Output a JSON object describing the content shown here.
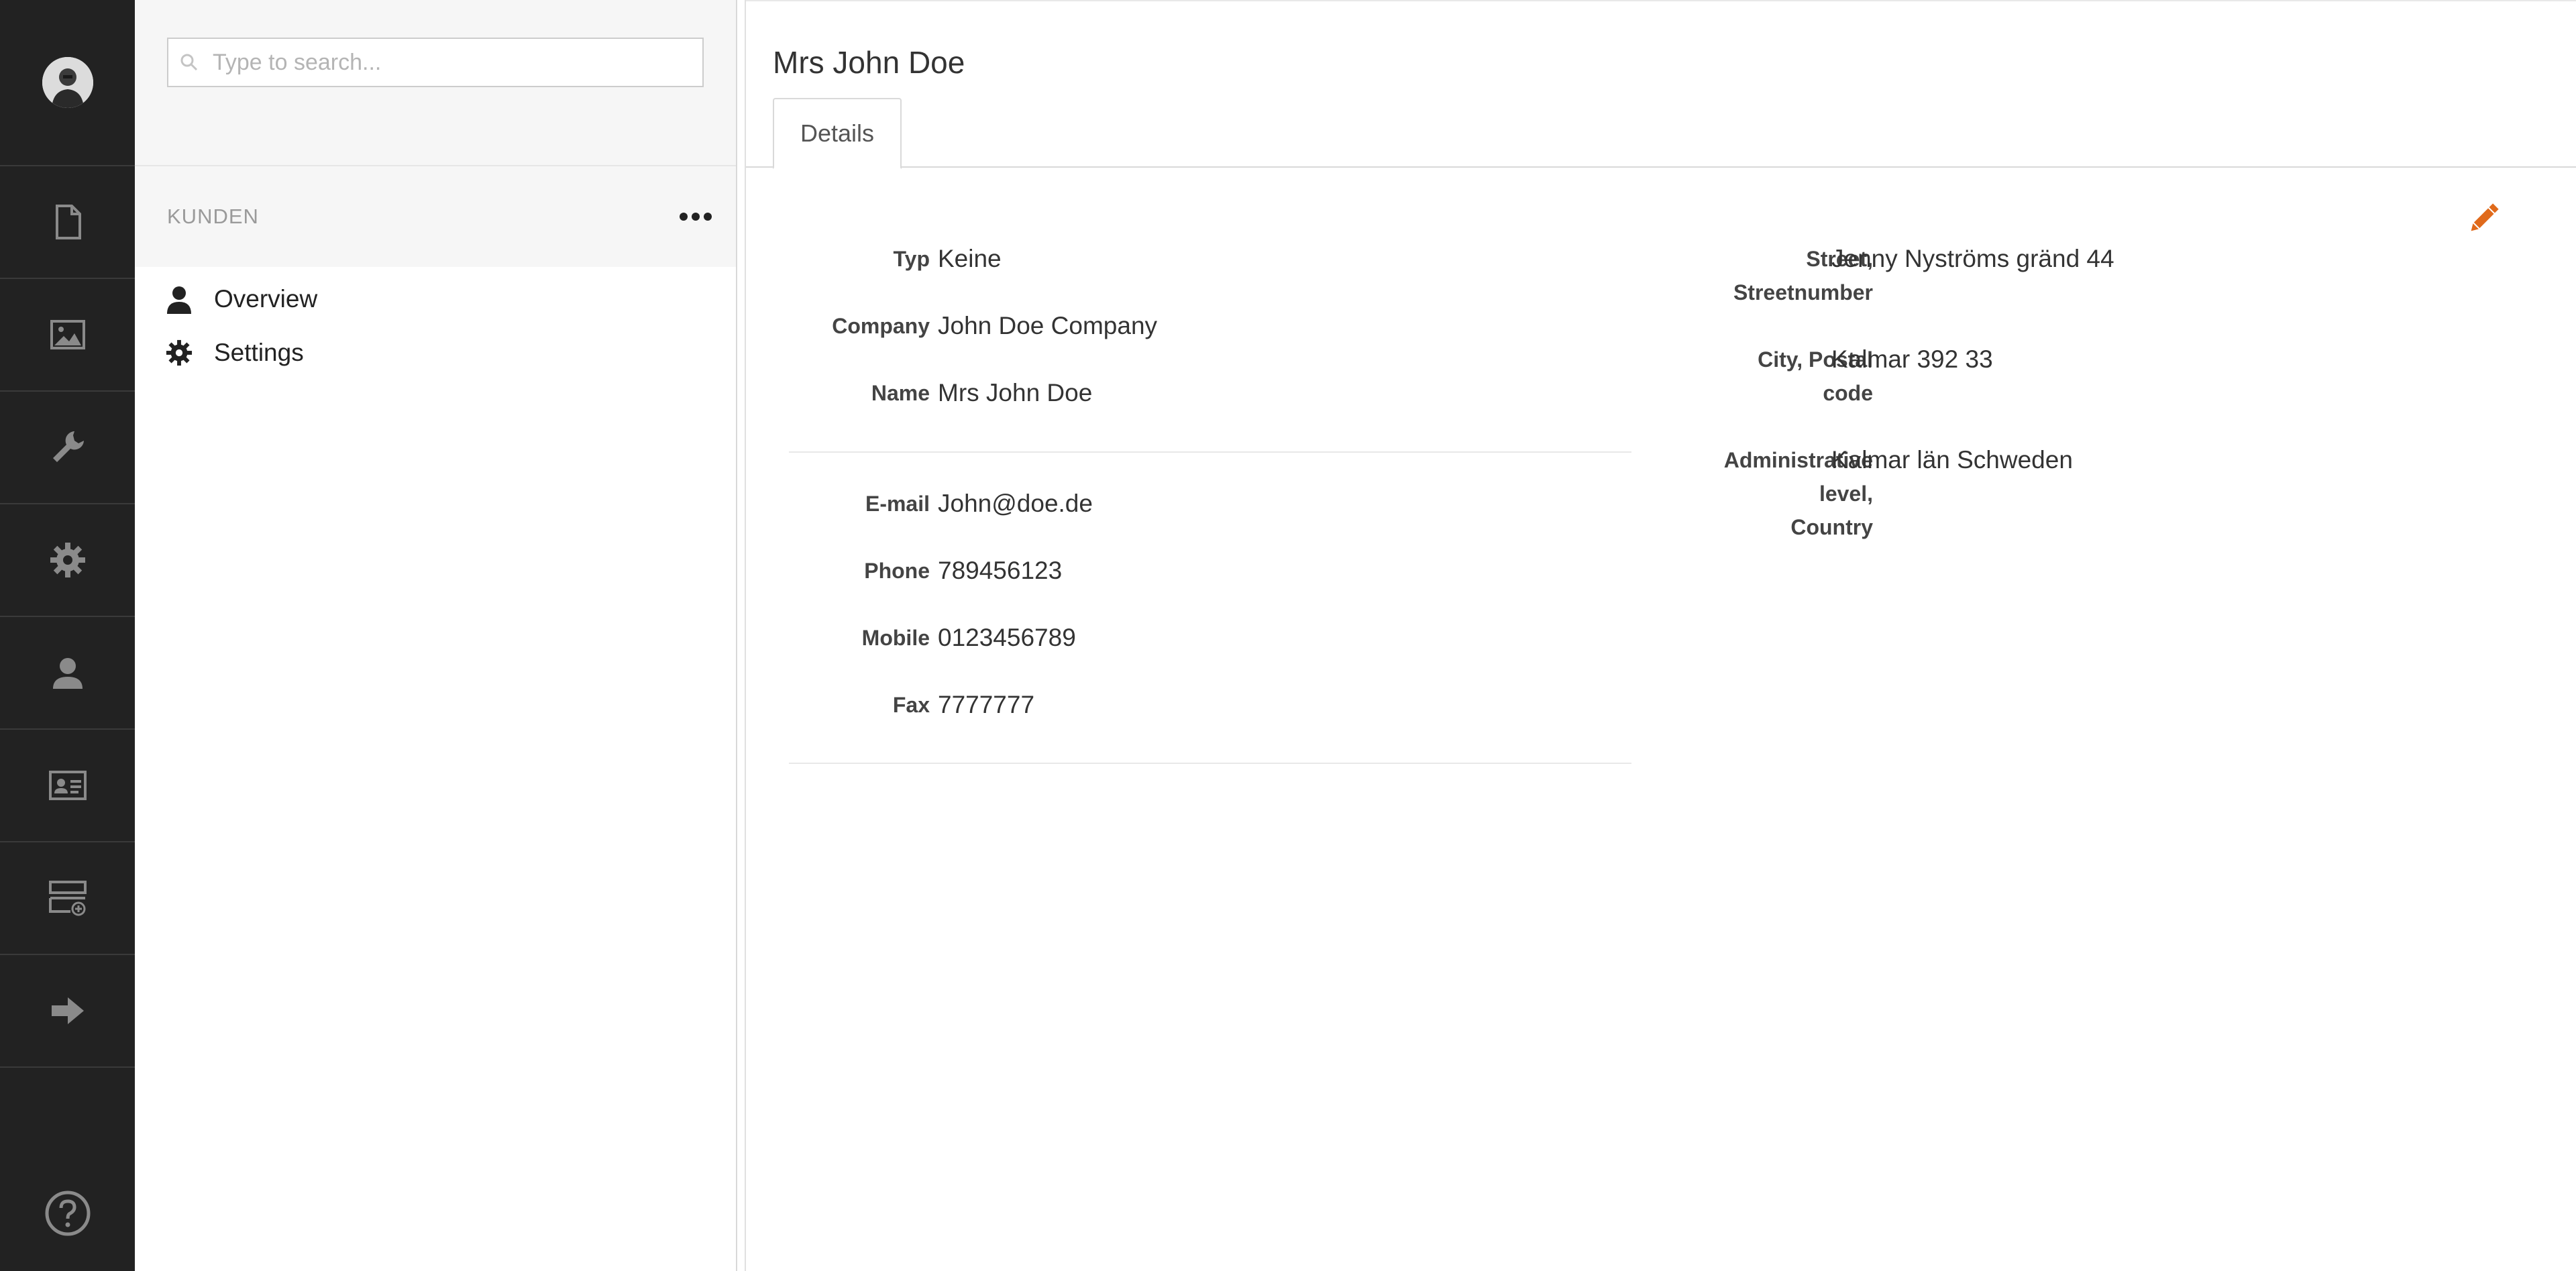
{
  "rail": {
    "items": [
      {
        "icon": "document-icon"
      },
      {
        "icon": "image-icon"
      },
      {
        "icon": "wrench-icon"
      },
      {
        "icon": "gear-icon"
      },
      {
        "icon": "user-icon"
      },
      {
        "icon": "contact-card-icon"
      },
      {
        "icon": "add-layout-icon"
      },
      {
        "icon": "arrow-right-icon"
      }
    ],
    "help_icon": "help-icon"
  },
  "subnav": {
    "search_placeholder": "Type to search...",
    "title": "KUNDEN",
    "items": [
      {
        "label": "Overview",
        "icon": "user-icon"
      },
      {
        "label": "Settings",
        "icon": "gear-icon"
      }
    ]
  },
  "main": {
    "title": "Mrs John Doe",
    "tab": "Details",
    "left_fields": [
      {
        "label": "Typ",
        "value": "Keine"
      },
      {
        "label": "Company",
        "value": "John Doe Company"
      },
      {
        "label": "Name",
        "value": "Mrs John Doe"
      },
      {
        "label": "E-mail",
        "value": "John@doe.de"
      },
      {
        "label": "Phone",
        "value": "789456123"
      },
      {
        "label": "Mobile",
        "value": "0123456789"
      },
      {
        "label": "Fax",
        "value": "7777777"
      }
    ],
    "right_fields": [
      {
        "label_lines": [
          "Street,",
          "Streetnumber"
        ],
        "value": "Jenny Nyströms gränd 44"
      },
      {
        "label_lines": [
          "City, Postal",
          "code"
        ],
        "value": "Kalmar 392 33"
      },
      {
        "label_lines": [
          "Administrative",
          "level,",
          "Country"
        ],
        "value": "Kalmar län Schweden"
      }
    ]
  },
  "colors": {
    "rail_bg": "#222222",
    "rail_icon": "#8a8a8a",
    "edit_accent": "#e06a1b"
  }
}
